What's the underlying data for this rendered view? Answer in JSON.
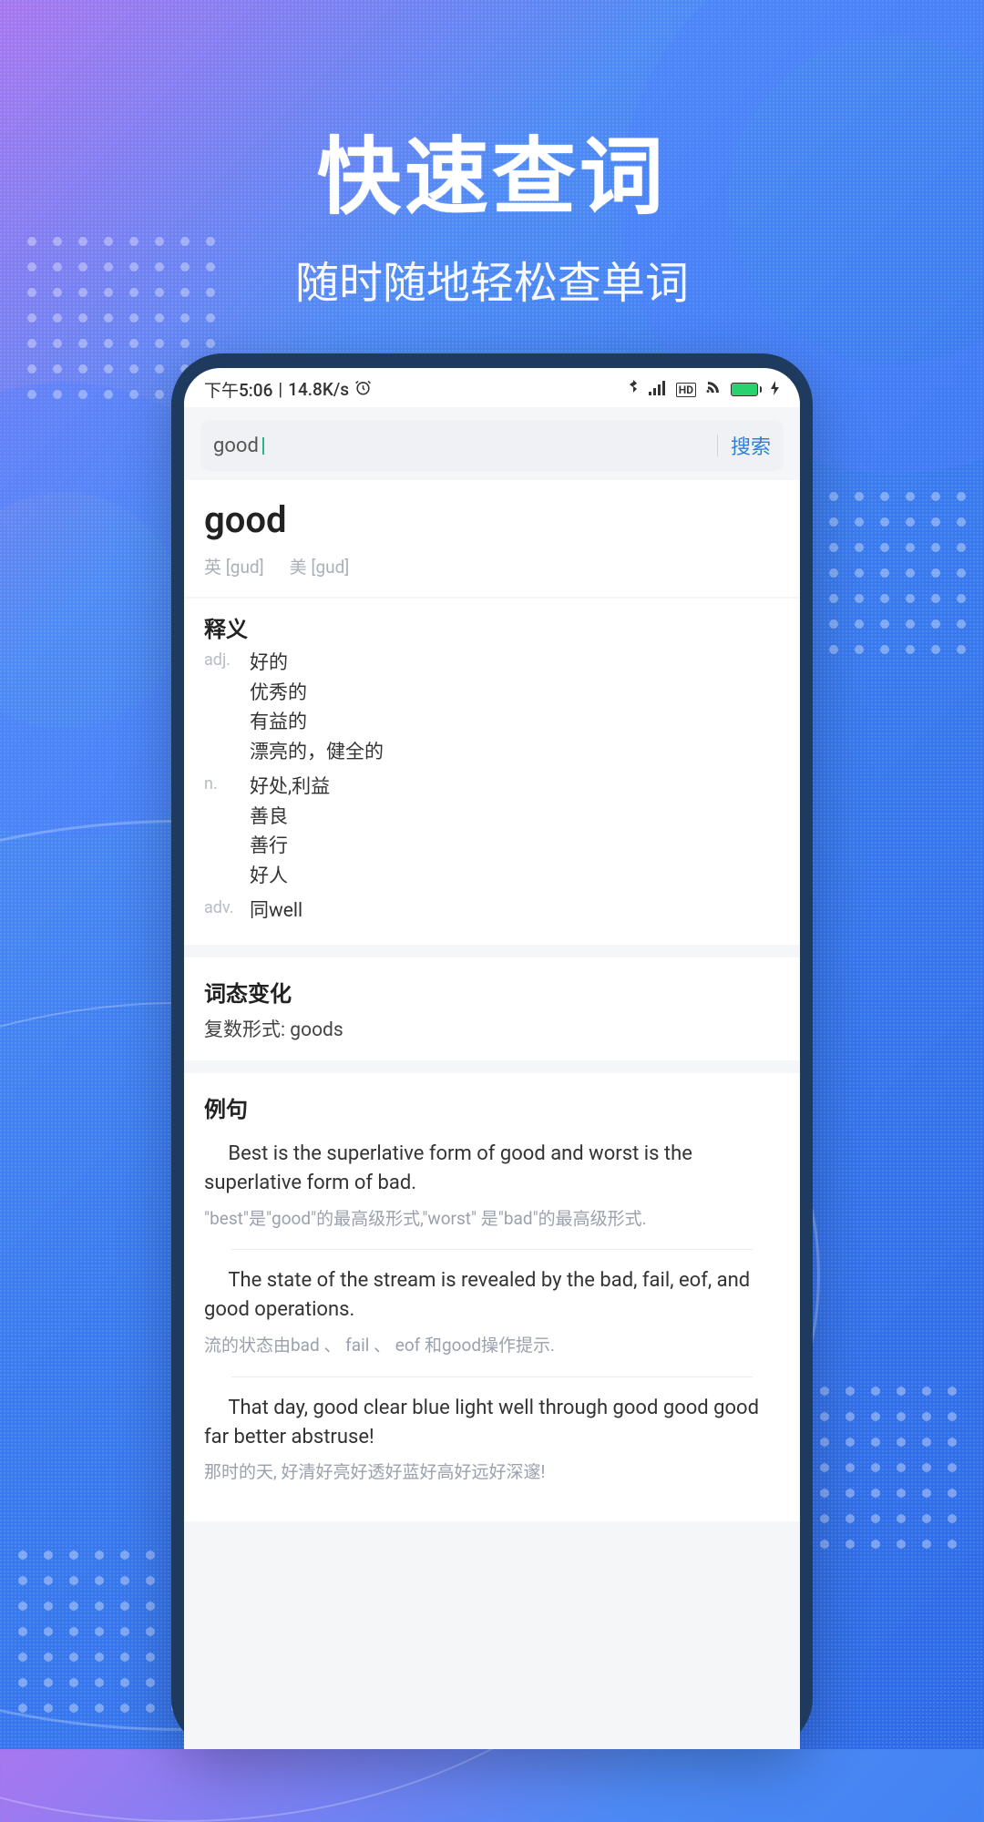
{
  "hero": {
    "title": "快速查词",
    "subtitle": "随时随地轻松查单词"
  },
  "status": {
    "time": "下午5:06",
    "speed": "14.8K/s",
    "alarm": "⏰"
  },
  "search": {
    "value": "good",
    "button": "搜索"
  },
  "entry": {
    "word": "good",
    "uk_label": "英",
    "uk_phon": "[gud]",
    "us_label": "美",
    "us_phon": "[gud]"
  },
  "definitions": {
    "title": "释义",
    "rows": [
      {
        "pos": "adj.",
        "meanings": [
          "好的",
          "优秀的",
          "有益的",
          "漂亮的，健全的"
        ]
      },
      {
        "pos": "n.",
        "meanings": [
          "好处,利益",
          "善良",
          "善行",
          "好人"
        ]
      },
      {
        "pos": "adv.",
        "meanings": [
          "同well"
        ]
      }
    ]
  },
  "morphology": {
    "title": "词态变化",
    "line": "复数形式: goods"
  },
  "examples": {
    "title": "例句",
    "items": [
      {
        "en": "Best is the superlative form of good and worst is the superlative form of bad.",
        "zh": "\"best\"是\"good\"的最高级形式,\"worst\" 是\"bad\"的最高级形式."
      },
      {
        "en": "The state of the stream is revealed by the bad, fail, eof, and good operations.",
        "zh": "流的状态由bad 、 fail 、 eof 和good操作提示."
      },
      {
        "en": "That day, good clear blue light well through good good good far better abstruse!",
        "zh": "那时的天, 好清好亮好透好蓝好高好远好深邃!"
      }
    ]
  }
}
